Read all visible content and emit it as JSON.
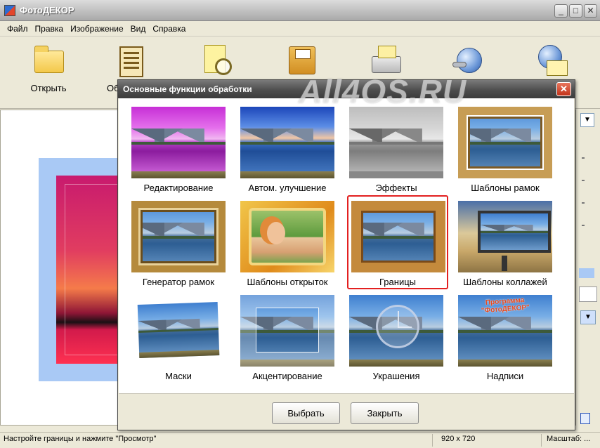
{
  "window": {
    "title": "ФотоДЕКОР",
    "controls": [
      "_",
      "□",
      "✕"
    ]
  },
  "menu": [
    "Файл",
    "Правка",
    "Изображение",
    "Вид",
    "Справка"
  ],
  "toolbar": {
    "items": [
      {
        "label": "Открыть",
        "icon": "open-folder-icon"
      },
      {
        "label": "Об",
        "icon": "document-icon"
      },
      {
        "label": "",
        "icon": "magnifier-icon"
      },
      {
        "label": "",
        "icon": "save-disk-icon"
      },
      {
        "label": "",
        "icon": "printer-icon"
      },
      {
        "label": "",
        "icon": "globe-key-icon"
      },
      {
        "label": "",
        "icon": "globe-news-icon"
      }
    ]
  },
  "watermark": "All4OS.RU",
  "dialog": {
    "title": "Основные функции обработки",
    "tiles": [
      {
        "label": "Редактирование",
        "selected": false
      },
      {
        "label": "Автом. улучшение",
        "selected": false
      },
      {
        "label": "Эффекты",
        "selected": false
      },
      {
        "label": "Шаблоны рамок",
        "selected": false
      },
      {
        "label": "Генератор рамок",
        "selected": false
      },
      {
        "label": "Шаблоны открыток",
        "selected": false
      },
      {
        "label": "Границы",
        "selected": true
      },
      {
        "label": "Шаблоны коллажей",
        "selected": false
      },
      {
        "label": "Маски",
        "selected": false
      },
      {
        "label": "Акцентирование",
        "selected": false
      },
      {
        "label": "Украшения",
        "selected": false
      },
      {
        "label": "Надписи",
        "selected": false
      }
    ],
    "inscription_sample": "Программа \"ФотоДЕКОР\"",
    "buttons": {
      "select": "Выбрать",
      "close": "Закрыть"
    }
  },
  "status": {
    "hint": "Настройте границы и нажмите \"Просмотр\"",
    "size": "920 x 720",
    "zoom_label": "Масштаб: ..."
  },
  "colors": {
    "selection": "#e32020",
    "dialog_title": "#4e4e4e",
    "preview_border": "#a9c9f5"
  }
}
